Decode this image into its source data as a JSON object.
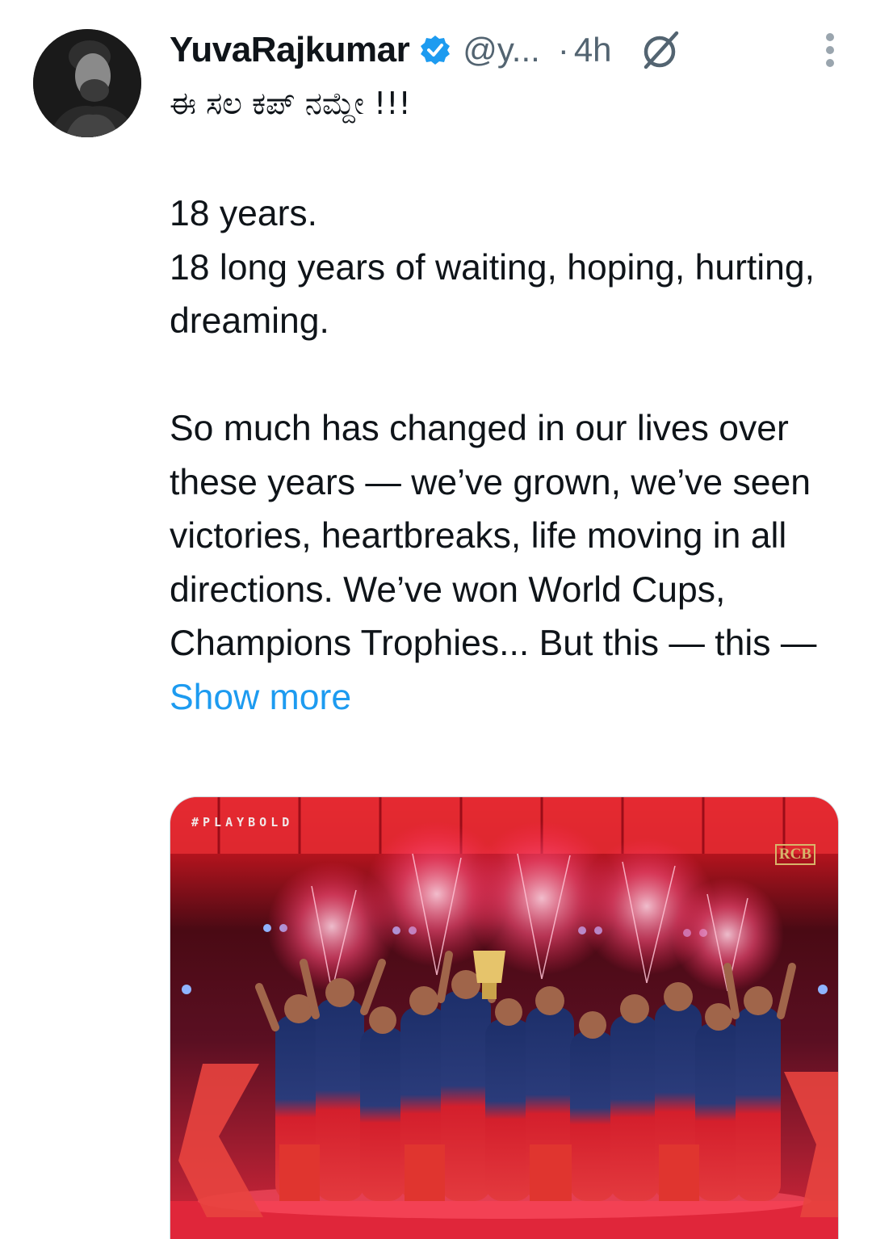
{
  "tweet": {
    "display_name": "YuvaRajkumar",
    "handle": "@y...",
    "separator": "·",
    "time": "4h",
    "kannada_line": "ಈ ಸಲ ಕಪ್ ನಮ್ದೇ !!!",
    "paragraphs": [
      [
        "18 years.",
        "18 long years of waiting, hoping, hurting, dreaming."
      ],
      [
        "So much has changed in our lives over these years — we’ve grown, we’ve seen victories, heartbreaks, life moving in all directions. We’ve won World Cups, Champions Trophies... But this — this —"
      ]
    ],
    "show_more": "Show more"
  },
  "media": {
    "tag": "#PLAYBOLD",
    "logo_text": "RCB"
  },
  "icons": {
    "verified": "verified-badge-icon",
    "grok": "grok-icon",
    "more": "more-vertical-icon"
  },
  "colors": {
    "text": "#0f1419",
    "secondary": "#536471",
    "link": "#1d9bf0",
    "verified": "#1d9bf0"
  }
}
